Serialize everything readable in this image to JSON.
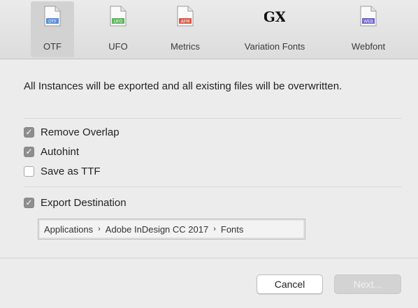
{
  "toolbar": {
    "tabs": [
      {
        "label": "OTF",
        "icon": "otf-file-icon",
        "badge": "OTF",
        "badge_color": "#5b8fd6",
        "selected": true
      },
      {
        "label": "UFO",
        "icon": "ufo-file-icon",
        "badge": "UFO",
        "badge_color": "#5bb55b",
        "selected": false
      },
      {
        "label": "Metrics",
        "icon": "metrics-file-icon",
        "badge": "AFM",
        "badge_color": "#d9574a",
        "selected": false
      },
      {
        "label": "Variation Fonts",
        "icon": "gx-icon",
        "badge": "GX",
        "selected": false
      },
      {
        "label": "Webfont",
        "icon": "webfont-file-icon",
        "badge": "WEB",
        "badge_color": "#6b63c9",
        "selected": false
      }
    ]
  },
  "message": "All Instances will be exported and all existing files will be overwritten.",
  "options": {
    "remove_overlap": {
      "label": "Remove Overlap",
      "checked": true
    },
    "autohint": {
      "label": "Autohint",
      "checked": true
    },
    "save_as_ttf": {
      "label": "Save as TTF",
      "checked": false
    },
    "export_destination": {
      "label": "Export Destination",
      "checked": true
    }
  },
  "destination_path": [
    "Applications",
    "Adobe InDesign CC 2017",
    "Fonts"
  ],
  "buttons": {
    "cancel": "Cancel",
    "next": "Next..."
  }
}
